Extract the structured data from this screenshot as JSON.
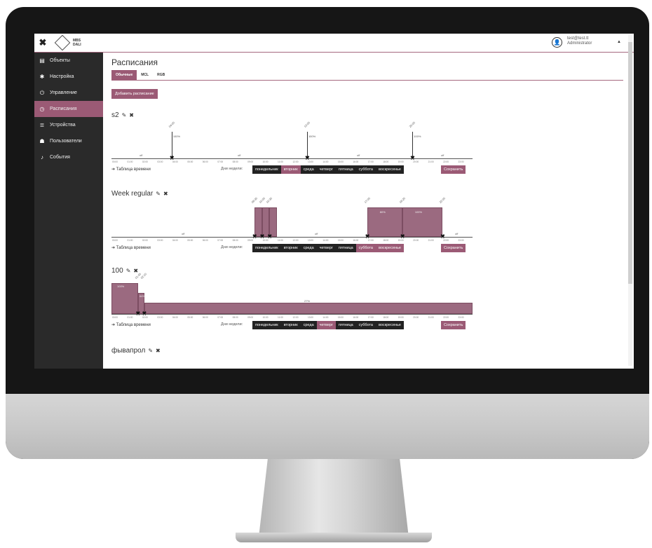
{
  "app": {
    "logo_text": "MBS\nDALI",
    "user_email": "test@test.tt",
    "user_role": "Administrator"
  },
  "sidebar": {
    "items": [
      {
        "label": "Объекты",
        "icon": "building-icon"
      },
      {
        "label": "Настройка",
        "icon": "gear-icon"
      },
      {
        "label": "Управление",
        "icon": "power-icon"
      },
      {
        "label": "Расписания",
        "icon": "clock-icon",
        "active": true
      },
      {
        "label": "Устройства",
        "icon": "database-icon"
      },
      {
        "label": "Пользователи",
        "icon": "users-icon"
      },
      {
        "label": "События",
        "icon": "bell-icon"
      }
    ]
  },
  "page": {
    "title": "Расписания",
    "tabs": [
      "Обычные",
      "MCL",
      "RGB"
    ],
    "add_button": "Добавить расписание"
  },
  "common": {
    "time_table": "Таблица времени",
    "days_label": "Дни недели:",
    "save": "Сохранить",
    "days": [
      "понедельник",
      "вторник",
      "среда",
      "четверг",
      "пятница",
      "суббота",
      "воскресенье"
    ],
    "hours": [
      "00:00",
      "01:00",
      "02:00",
      "03:00",
      "04:00",
      "05:00",
      "06:00",
      "07:00",
      "08:00",
      "09:00",
      "10:00",
      "11:00",
      "12:00",
      "13:00",
      "14:00",
      "15:00",
      "16:00",
      "17:00",
      "18:00",
      "19:00",
      "20:00",
      "21:00",
      "22:00",
      "23:00"
    ],
    "off": "off"
  },
  "schedules": [
    {
      "name": "s2",
      "active_days": [
        1
      ],
      "points": [
        {
          "time": "04:00",
          "level": "100%"
        },
        {
          "time": "13:00",
          "level": "100%"
        },
        {
          "time": "20:00",
          "level": "100%"
        }
      ]
    },
    {
      "name": "Week regular",
      "active_days": [
        5,
        6
      ],
      "points": [
        {
          "time": "09:30",
          "level": ""
        },
        {
          "time": "10:00",
          "level": ""
        },
        {
          "time": "10:30",
          "level": ""
        },
        {
          "time": "17:00",
          "level": "80%"
        },
        {
          "time": "19:20",
          "level": "100%"
        },
        {
          "time": "22:00",
          "level": ""
        }
      ]
    },
    {
      "name": "100",
      "active_days": [
        3
      ],
      "points": [
        {
          "time": "01:45",
          "level": "100%"
        },
        {
          "time": "02:10",
          "level": "64%"
        },
        {
          "time": "",
          "level": "27%"
        }
      ]
    },
    {
      "name": "фывапрол",
      "active_days": [],
      "points": []
    }
  ]
}
